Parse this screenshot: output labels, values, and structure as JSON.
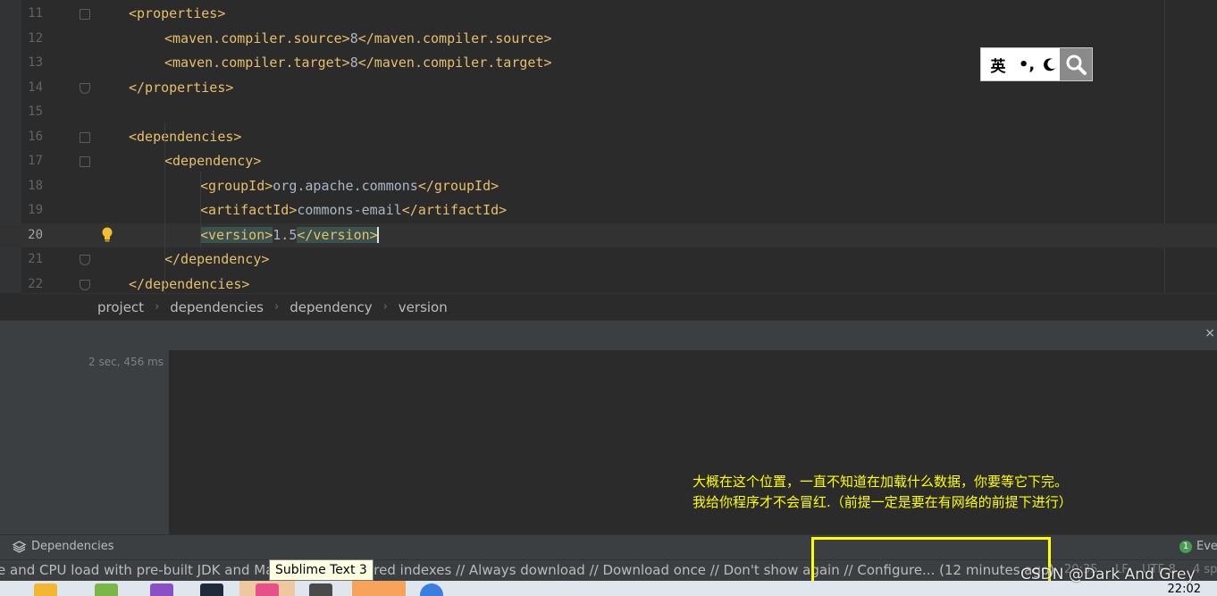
{
  "editor": {
    "lines": [
      {
        "num": "11",
        "indent": 1,
        "parts": [
          {
            "t": "<properties>",
            "c": "tag"
          }
        ],
        "fold": "start"
      },
      {
        "num": "12",
        "indent": 2,
        "parts": [
          {
            "t": "<maven.compiler.source>",
            "c": "tag"
          },
          {
            "t": "8",
            "c": "val"
          },
          {
            "t": "</maven.compiler.source>",
            "c": "tag"
          }
        ],
        "fold": ""
      },
      {
        "num": "13",
        "indent": 2,
        "parts": [
          {
            "t": "<maven.compiler.target>",
            "c": "tag"
          },
          {
            "t": "8",
            "c": "val"
          },
          {
            "t": "</maven.compiler.target>",
            "c": "tag"
          }
        ],
        "fold": ""
      },
      {
        "num": "14",
        "indent": 1,
        "parts": [
          {
            "t": "</properties>",
            "c": "tag"
          }
        ],
        "fold": "end"
      },
      {
        "num": "15",
        "indent": 0,
        "parts": [],
        "fold": ""
      },
      {
        "num": "16",
        "indent": 1,
        "parts": [
          {
            "t": "<dependencies>",
            "c": "tag"
          }
        ],
        "fold": "start"
      },
      {
        "num": "17",
        "indent": 2,
        "parts": [
          {
            "t": "<dependency>",
            "c": "tag"
          }
        ],
        "fold": "start"
      },
      {
        "num": "18",
        "indent": 3,
        "parts": [
          {
            "t": "<groupId>",
            "c": "tag"
          },
          {
            "t": "org.apache.commons",
            "c": "val"
          },
          {
            "t": "</groupId>",
            "c": "tag"
          }
        ],
        "fold": ""
      },
      {
        "num": "19",
        "indent": 3,
        "parts": [
          {
            "t": "<artifactId>",
            "c": "tag"
          },
          {
            "t": "commons-email",
            "c": "val"
          },
          {
            "t": "</artifactId>",
            "c": "tag"
          }
        ],
        "fold": ""
      },
      {
        "num": "20",
        "indent": 3,
        "parts": [
          {
            "t": "<version>",
            "c": "tag hl-tag"
          },
          {
            "t": "1.5",
            "c": "val"
          },
          {
            "t": "</version>",
            "c": "tag hl-tag"
          }
        ],
        "fold": "",
        "current": true
      },
      {
        "num": "21",
        "indent": 2,
        "parts": [
          {
            "t": "</dependency>",
            "c": "tag"
          }
        ],
        "fold": "end"
      },
      {
        "num": "22",
        "indent": 1,
        "parts": [
          {
            "t": "</dependencies>",
            "c": "tag"
          }
        ],
        "fold": "end"
      }
    ]
  },
  "breadcrumb": [
    "project",
    "dependencies",
    "dependency",
    "version"
  ],
  "panel": {
    "elapsed": "2 sec, 456 ms",
    "close_glyph": "×"
  },
  "annotation": {
    "line1": "大概在这个位置，一直不知道在加载什么数据，你要等它下完。",
    "line2": "我给你程序才不会冒红.（前提一定是要在有网络的前提下进行）"
  },
  "tool_windows": {
    "dependencies_label": "Dependencies",
    "event_badge": "1",
    "event_label": "Eve"
  },
  "status": {
    "message": "e and CPU load with pre-built JDK and Maven library shared indexes // Always download // Download once // Don't show again // Configure... (12 minutes ago)",
    "position": "20:35",
    "line_sep": "LF",
    "encoding": "UTF-8",
    "indent": "4 sp"
  },
  "tooltip": "Sublime Text 3",
  "ime": {
    "lang": "英",
    "punct": "•,"
  },
  "taskbar": {
    "clock": "22:02"
  },
  "watermark": "CSDN @Dark And Grey"
}
